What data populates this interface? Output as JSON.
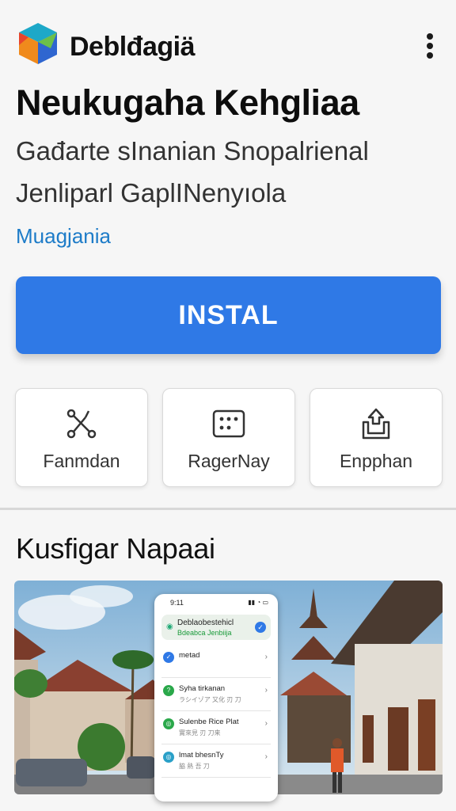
{
  "app": {
    "brand": "Deblđagiä",
    "title": "Neukugaha Kehgliaa",
    "subtitle_line1": "Gađarte sInanian  Snopalrienal",
    "subtitle_line2": "Jenliparl GaplINenyıola",
    "category": "Muagjania",
    "install_label": "INSTAL"
  },
  "actions": [
    {
      "label": "Fanmdan",
      "icon": "tools-icon"
    },
    {
      "label": "RagerNay",
      "icon": "keypad-icon"
    },
    {
      "label": "Enpphan",
      "icon": "share-icon"
    }
  ],
  "section": {
    "title": "Kusfigar Napaai"
  },
  "preview_phone": {
    "time": "9:11",
    "header_title": "Deblaobestehicl",
    "header_sub": "Bdeabca Jenbiija",
    "rows": [
      {
        "title": "metad",
        "sub": "",
        "icon_color": "#2f79e6"
      },
      {
        "title": "Syha tirkanan",
        "sub": "ラシイゾア 又化 刃 刀",
        "icon_color": "#2aa84a"
      },
      {
        "title": "Sulenbe Rice Plat",
        "sub": "實來見 刃 刀来",
        "icon_color": "#2aa84a"
      },
      {
        "title": "lmat bhesnTy",
        "sub": "脇 熱 吾 刀",
        "icon_color": "#2aa0c8"
      }
    ]
  },
  "colors": {
    "accent": "#2f79e6",
    "category": "#1e7cc8",
    "background": "#f6f6f6"
  }
}
